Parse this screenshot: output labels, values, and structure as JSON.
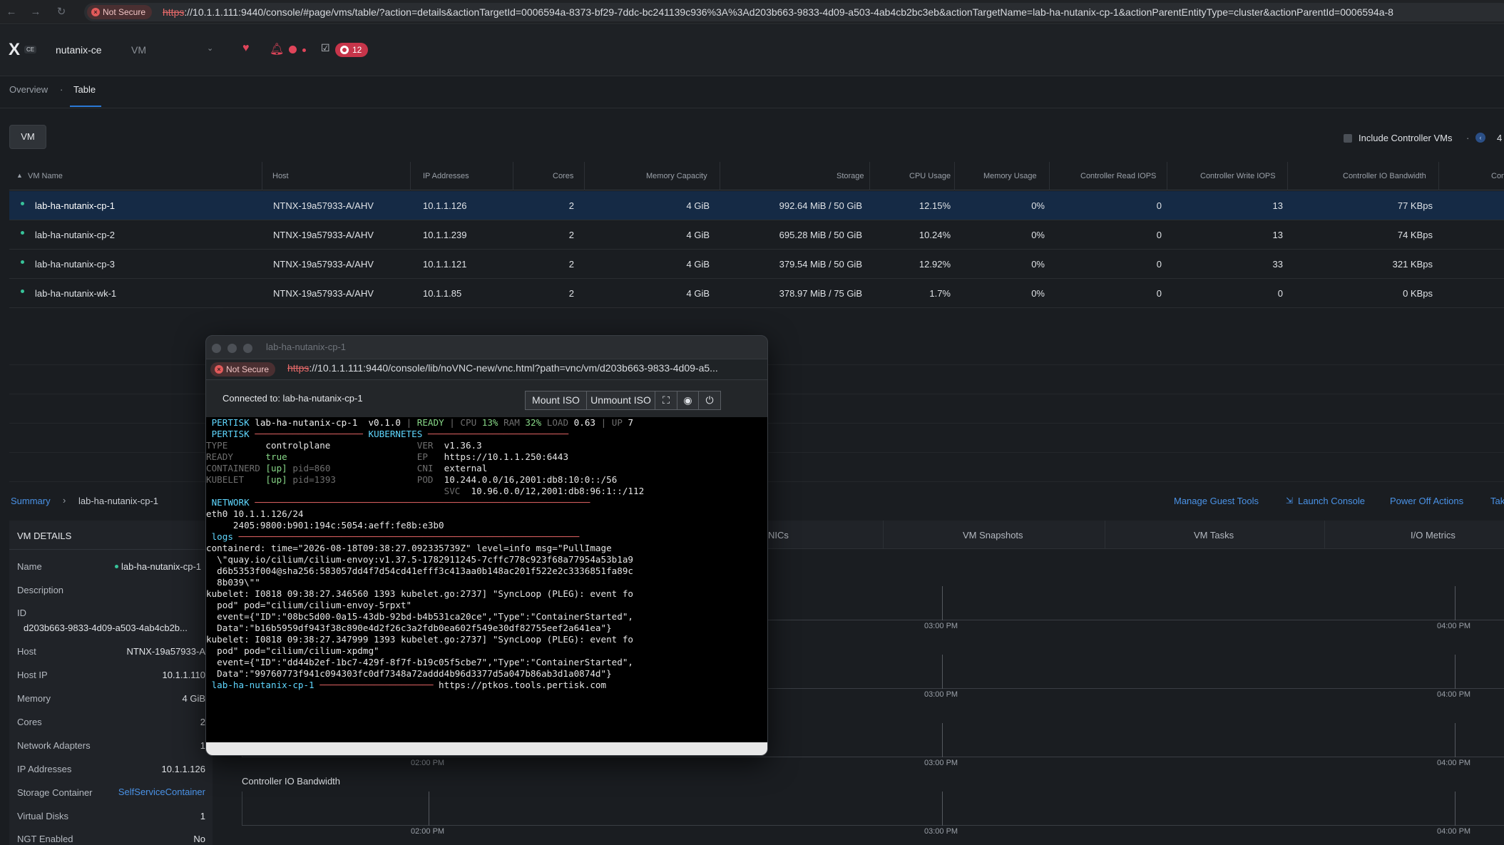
{
  "browser": {
    "not_secure": "Not Secure",
    "url_scheme": "https",
    "url_rest": "://10.1.1.111:9440/console/#page/vms/table/?action=details&actionTargetId=0006594a-8373-bf29-7ddc-bc241139c936%3A%3Ad203b663-9833-4d09-a503-4ab4cb2bc3eb&actionTargetName=lab-ha-nutanix-cp-1&actionParentEntityType=cluster&actionParentId=0006594a-8"
  },
  "header": {
    "logo": "X",
    "logo_badge": "CE",
    "cluster": "nutanix-ce",
    "entity": "VM",
    "task_count": "12"
  },
  "subtabs": {
    "overview": "Overview",
    "dot": "·",
    "table": "Table"
  },
  "toolbar": {
    "vm_button": "VM",
    "include_controller": "Include Controller VMs",
    "pager_sep": "·",
    "pager_num": "4"
  },
  "table": {
    "columns": [
      "VM Name",
      "Host",
      "IP Addresses",
      "Cores",
      "Memory Capacity",
      "Storage",
      "CPU Usage",
      "Memory Usage",
      "Controller Read IOPS",
      "Controller Write IOPS",
      "Controller IO Bandwidth",
      "Con"
    ],
    "rows": [
      {
        "name": "lab-ha-nutanix-cp-1",
        "host": "NTNX-19a57933-A/AHV",
        "ip": "10.1.1.126",
        "cores": "2",
        "mem": "4 GiB",
        "storage": "992.64 MiB / 50 GiB",
        "cpu": "12.15%",
        "memu": "0%",
        "riops": "0",
        "wiops": "13",
        "bw": "77 KBps"
      },
      {
        "name": "lab-ha-nutanix-cp-2",
        "host": "NTNX-19a57933-A/AHV",
        "ip": "10.1.1.239",
        "cores": "2",
        "mem": "4 GiB",
        "storage": "695.28 MiB / 50 GiB",
        "cpu": "10.24%",
        "memu": "0%",
        "riops": "0",
        "wiops": "13",
        "bw": "74 KBps"
      },
      {
        "name": "lab-ha-nutanix-cp-3",
        "host": "NTNX-19a57933-A/AHV",
        "ip": "10.1.1.121",
        "cores": "2",
        "mem": "4 GiB",
        "storage": "379.54 MiB / 50 GiB",
        "cpu": "12.92%",
        "memu": "0%",
        "riops": "0",
        "wiops": "33",
        "bw": "321 KBps"
      },
      {
        "name": "lab-ha-nutanix-wk-1",
        "host": "NTNX-19a57933-A/AHV",
        "ip": "10.1.1.85",
        "cores": "2",
        "mem": "4 GiB",
        "storage": "378.97 MiB / 75 GiB",
        "cpu": "1.7%",
        "memu": "0%",
        "riops": "0",
        "wiops": "0",
        "bw": "0 KBps"
      }
    ]
  },
  "summary": {
    "link": "Summary",
    "sep": "›",
    "vm": "lab-ha-nutanix-cp-1",
    "actions": [
      "Manage Guest Tools",
      "Launch Console",
      "Power Off Actions",
      "Tak"
    ]
  },
  "details": {
    "title": "VM DETAILS",
    "name_label": "Name",
    "name_value": "lab-ha-nutanix-cp-1",
    "description_label": "Description",
    "id_label": "ID",
    "id_value": "d203b663-9833-4d09-a503-4ab4cb2b...",
    "host_label": "Host",
    "host_value": "NTNX-19a57933-A",
    "hostip_label": "Host IP",
    "hostip_value": "10.1.1.110",
    "memory_label": "Memory",
    "memory_value": "4 GiB",
    "cores_label": "Cores",
    "cores_value": "2",
    "net_label": "Network Adapters",
    "net_value": "1",
    "ip_label": "IP Addresses",
    "ip_value": "10.1.1.126",
    "storage_label": "Storage Container",
    "storage_value": "SelfServiceContainer",
    "disks_label": "Virtual Disks",
    "disks_value": "1",
    "ngt_label": "NGT Enabled",
    "ngt_value": "No"
  },
  "right_tabs": [
    "NICs",
    "VM Snapshots",
    "VM Tasks",
    "I/O Metrics"
  ],
  "charts": {
    "times": [
      "02:00 PM",
      "03:00 PM",
      "04:00 PM"
    ],
    "controller_title": "Controller IO Bandwidth"
  },
  "console": {
    "title": "lab-ha-nutanix-cp-1",
    "not_secure": "Not Secure",
    "url_scheme": "https",
    "url_rest": "://10.1.1.111:9440/console/lib/noVNC-new/vnc.html?path=vnc/vm/d203b663-9833-4d09-a5...",
    "connected": "Connected to: lab-ha-nutanix-cp-1",
    "mount_iso": "Mount ISO",
    "unmount_iso": "Unmount ISO",
    "terminal": {
      "l1_a": " PERTISK",
      "l1_b": " lab-ha-nutanix-cp-1  v0.1.0 ",
      "l1_c": "| ",
      "l1_d": "READY",
      "l1_e": " | CPU ",
      "l1_f": "13%",
      "l1_g": " RAM ",
      "l1_h": "32%",
      "l1_i": " LOAD ",
      "l1_j": "0.63",
      "l1_k": " | UP ",
      "l1_l": "7",
      "l2_a": " PERTISK ",
      "l2_b": "──────────────────── ",
      "l2_c": "KUBERNETES",
      "l2_d": " ──────────────────────────",
      "l3_a": "TYPE       ",
      "l3_b": "controlplane",
      "l3_c": "                ",
      "l3_d": "VER",
      "l3_e": "  v1.36.3",
      "l4_a": "READY      ",
      "l4_b": "true",
      "l4_c": "                        ",
      "l4_d": "EP",
      "l4_e": "   https://10.1.1.250:6443",
      "l5_a": "CONTAINERD ",
      "l5_b": "[up]",
      "l5_c": " pid=860",
      "l5_d": "                ",
      "l5_e": "CNI",
      "l5_f": "  external",
      "l6_a": "KUBELET    ",
      "l6_b": "[up]",
      "l6_c": " pid=1393",
      "l6_d": "               ",
      "l6_e": "POD",
      "l6_f": "  10.244.0.0/16,2001:db8:10:0::/56",
      "l7_a": "                                            ",
      "l7_b": "SVC",
      "l7_c": "  10.96.0.0/12,2001:db8:96:1::/112",
      "l8_a": " NETWORK ",
      "l8_b": "──────────────────────────────────────────────────────────────",
      "l9": "eth0 10.1.1.126/24",
      "l10": "     2405:9800:b901:194c:5054:aeff:fe8b:e3b0",
      "l11_a": " logs ",
      "l11_b": "───────────────────────────────────────────────────────────────",
      "l12": "containerd: time=\"2026-08-18T09:38:27.092335739Z\" level=info msg=\"PullImage",
      "l13": "  \\\"quay.io/cilium/cilium-envoy:v1.37.5-1782911245-7cffc778c923f68a77954a53b1a9",
      "l14": "  d6b5353f004@sha256:583057dd4f7d54cd41efff3c413aa0b148ac201f522e2c3336851fa89c",
      "l15": "  8b039\\\"\"",
      "l16": "kubelet: I0818 09:38:27.346560 1393 kubelet.go:2737] \"SyncLoop (PLEG): event fo",
      "l17": "  pod\" pod=\"cilium/cilium-envoy-5rpxt\"",
      "l18": "  event={\"ID\":\"08bc5d00-0a15-43db-92bd-b4b531ca20ce\",\"Type\":\"ContainerStarted\",",
      "l19": "  Data\":\"b16b5959df943f38c890e4d2f26c3a2fdb0ea602f549e30df82755eef2a641ea\"}",
      "l20": "kubelet: I0818 09:38:27.347999 1393 kubelet.go:2737] \"SyncLoop (PLEG): event fo",
      "l21": "  pod\" pod=\"cilium/cilium-xpdmg\"",
      "l22": "  event={\"ID\":\"dd44b2ef-1bc7-429f-8f7f-b19c05f5cbe7\",\"Type\":\"ContainerStarted\",",
      "l23": "  Data\":\"99760773f941c094303fc0df7348a72addd4b96d3377d5a047b86ab3d1a0874d\"}",
      "l24_a": " lab-ha-nutanix-cp-1 ",
      "l24_b": "─────────────────────",
      "l24_c": " https://ptkos.tools.pertisk.com"
    }
  }
}
